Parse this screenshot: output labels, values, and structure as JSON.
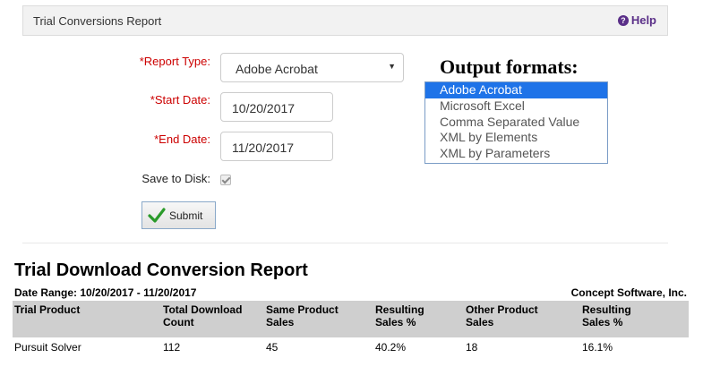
{
  "header": {
    "title": "Trial Conversions Report",
    "help_label": "Help"
  },
  "form": {
    "report_type_label": "Report Type:",
    "report_type_value": "Adobe Acrobat",
    "start_date_label": "Start Date:",
    "start_date_value": "10/20/2017",
    "end_date_label": "End Date:",
    "end_date_value": "11/20/2017",
    "save_to_disk_label": "Save to Disk:",
    "save_to_disk_checked": true,
    "required_marker": "*",
    "submit_label": "Submit"
  },
  "output_formats": {
    "heading": "Output formats:",
    "options": [
      "Adobe Acrobat",
      "Microsoft Excel",
      "Comma Separated Value",
      "XML by Elements",
      "XML by Parameters"
    ],
    "selected_index": 0
  },
  "report": {
    "title": "Trial Download Conversion Report",
    "date_range": "Date Range:  10/20/2017 - 11/20/2017",
    "company": "Concept Software, Inc.",
    "columns": [
      "Trial Product",
      "Total Download Count",
      "Same Product Sales",
      "Resulting Sales %",
      "Other Product Sales",
      "Resulting Sales %"
    ],
    "columns_split": [
      [
        "Trial Product",
        ""
      ],
      [
        "Total Download",
        "Count"
      ],
      [
        "Same Product",
        "Sales"
      ],
      [
        "Resulting",
        "Sales %"
      ],
      [
        "Other Product",
        "Sales"
      ],
      [
        "Resulting",
        "Sales %"
      ]
    ],
    "rows": [
      [
        "Pursuit Solver",
        "112",
        "45",
        "40.2%",
        "18",
        "16.1%"
      ]
    ]
  },
  "colors": {
    "accent_purple": "#5a2f88",
    "required_red": "#cc0000",
    "selection_blue": "#1e73e8"
  }
}
